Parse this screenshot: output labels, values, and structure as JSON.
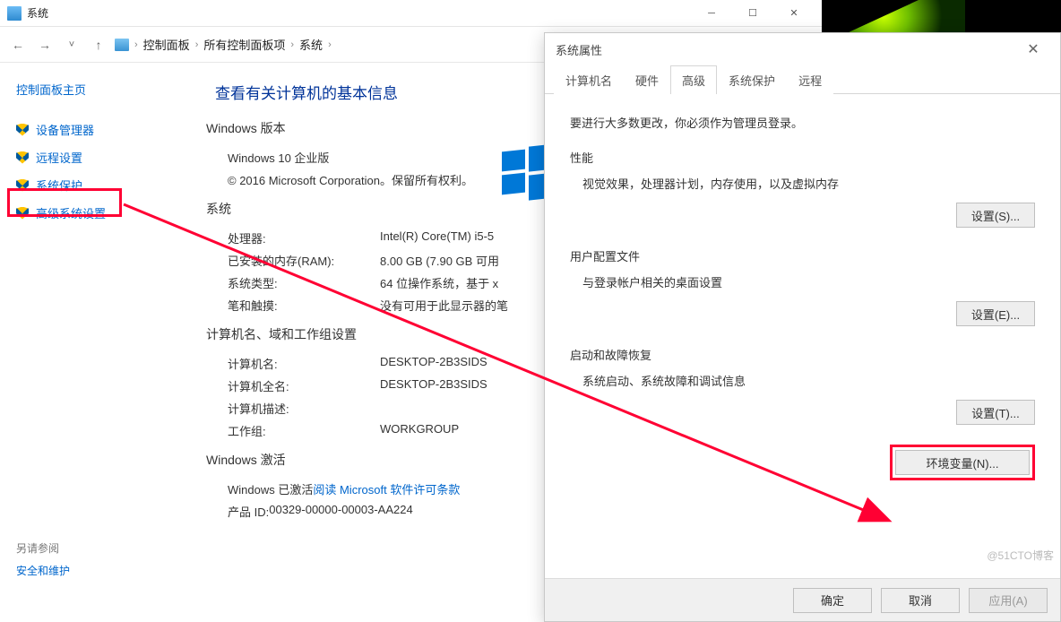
{
  "sysWindow": {
    "title": "系统",
    "breadcrumb": {
      "cp": "控制面板",
      "all": "所有控制面板项",
      "sys": "系统"
    }
  },
  "sidebar": {
    "home": "控制面板主页",
    "items": [
      "设备管理器",
      "远程设置",
      "系统保护",
      "高级系统设置"
    ],
    "seeAlso": "另请参阅",
    "securityMaint": "安全和维护"
  },
  "content": {
    "heading": "查看有关计算机的基本信息",
    "winEditionLabel": "Windows 版本",
    "edition": "Windows 10 企业版",
    "copyright": "© 2016 Microsoft Corporation。保留所有权利。",
    "systemLabel": "系统",
    "cpuK": "处理器:",
    "cpuV": "Intel(R) Core(TM) i5-5",
    "ramK": "已安装的内存(RAM):",
    "ramV": "8.00 GB (7.90 GB 可用",
    "typeK": "系统类型:",
    "typeV": "64 位操作系统，基于 x",
    "penK": "笔和触摸:",
    "penV": "没有可用于此显示器的笔",
    "compGroupLabel": "计算机名、域和工作组设置",
    "compNameK": "计算机名:",
    "compNameV": "DESKTOP-2B3SIDS",
    "fullNameK": "计算机全名:",
    "fullNameV": "DESKTOP-2B3SIDS",
    "descK": "计算机描述:",
    "descV": "",
    "wgK": "工作组:",
    "wgV": "WORKGROUP",
    "activationLabel": "Windows 激活",
    "activatedText": "Windows 已激活  ",
    "licenseLink": "阅读 Microsoft 软件许可条款",
    "productIdK": "产品 ID: ",
    "productIdV": "00329-00000-00003-AA224"
  },
  "dialog": {
    "title": "系统属性",
    "tabs": [
      "计算机名",
      "硬件",
      "高级",
      "系统保护",
      "远程"
    ],
    "intro": "要进行大多数更改，你必须作为管理员登录。",
    "perf": {
      "title": "性能",
      "desc": "视觉效果，处理器计划，内存使用，以及虚拟内存",
      "btn": "设置(S)..."
    },
    "user": {
      "title": "用户配置文件",
      "desc": "与登录帐户相关的桌面设置",
      "btn": "设置(E)..."
    },
    "start": {
      "title": "启动和故障恢复",
      "desc": "系统启动、系统故障和调试信息",
      "btn": "设置(T)..."
    },
    "envBtn": "环境变量(N)...",
    "ok": "确定",
    "cancel": "取消",
    "apply": "应用(A)"
  },
  "watermark": "@51CTO博客"
}
